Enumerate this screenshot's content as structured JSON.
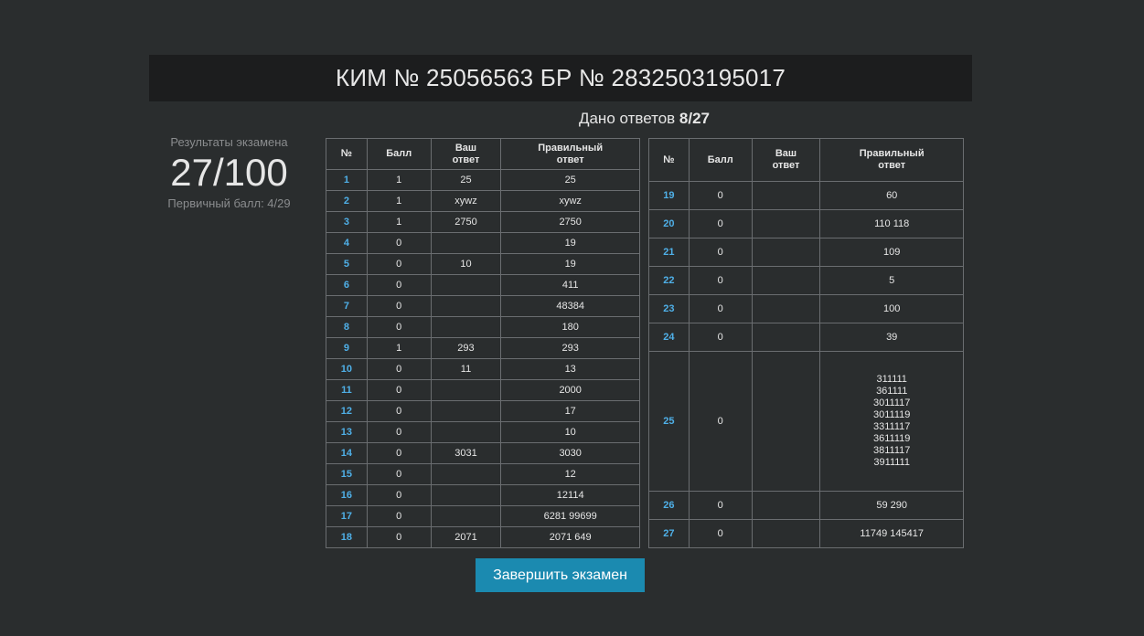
{
  "header": {
    "title": "КИМ № 25056563 БР № 2832503195017"
  },
  "answers_given": {
    "label": "Дано ответов",
    "value": "8/27"
  },
  "results": {
    "label": "Результаты экзамена",
    "score": "27/100",
    "primary": "Первичный балл: 4/29"
  },
  "columns": {
    "num": "№",
    "score": "Балл",
    "your_answer": "Ваш ответ",
    "correct_answer": "Правильный ответ"
  },
  "left_rows": [
    {
      "n": "1",
      "score": "1",
      "yours": "25",
      "correct": "25"
    },
    {
      "n": "2",
      "score": "1",
      "yours": "xywz",
      "correct": "xywz"
    },
    {
      "n": "3",
      "score": "1",
      "yours": "2750",
      "correct": "2750"
    },
    {
      "n": "4",
      "score": "0",
      "yours": "",
      "correct": "19"
    },
    {
      "n": "5",
      "score": "0",
      "yours": "10",
      "correct": "19"
    },
    {
      "n": "6",
      "score": "0",
      "yours": "",
      "correct": "411"
    },
    {
      "n": "7",
      "score": "0",
      "yours": "",
      "correct": "48384"
    },
    {
      "n": "8",
      "score": "0",
      "yours": "",
      "correct": "180"
    },
    {
      "n": "9",
      "score": "1",
      "yours": "293",
      "correct": "293"
    },
    {
      "n": "10",
      "score": "0",
      "yours": "11",
      "correct": "13"
    },
    {
      "n": "11",
      "score": "0",
      "yours": "",
      "correct": "2000"
    },
    {
      "n": "12",
      "score": "0",
      "yours": "",
      "correct": "17"
    },
    {
      "n": "13",
      "score": "0",
      "yours": "",
      "correct": "10"
    },
    {
      "n": "14",
      "score": "0",
      "yours": "3031",
      "correct": "3030"
    },
    {
      "n": "15",
      "score": "0",
      "yours": "",
      "correct": "12"
    },
    {
      "n": "16",
      "score": "0",
      "yours": "",
      "correct": "12114"
    },
    {
      "n": "17",
      "score": "0",
      "yours": "",
      "correct": "6281 99699"
    },
    {
      "n": "18",
      "score": "0",
      "yours": "2071",
      "correct": "2071 649"
    }
  ],
  "right_rows": [
    {
      "n": "19",
      "score": "0",
      "yours": "",
      "correct": [
        "60"
      ]
    },
    {
      "n": "20",
      "score": "0",
      "yours": "",
      "correct": [
        "110 118"
      ]
    },
    {
      "n": "21",
      "score": "0",
      "yours": "",
      "correct": [
        "109"
      ]
    },
    {
      "n": "22",
      "score": "0",
      "yours": "",
      "correct": [
        "5"
      ]
    },
    {
      "n": "23",
      "score": "0",
      "yours": "",
      "correct": [
        "100"
      ]
    },
    {
      "n": "24",
      "score": "0",
      "yours": "",
      "correct": [
        "39"
      ]
    },
    {
      "n": "25",
      "score": "0",
      "yours": "",
      "correct": [
        "311111",
        "361111",
        "3011117",
        "3011119",
        "3311117",
        "3611119",
        "3811117",
        "3911111"
      ]
    },
    {
      "n": "26",
      "score": "0",
      "yours": "",
      "correct": [
        "59 290"
      ]
    },
    {
      "n": "27",
      "score": "0",
      "yours": "",
      "correct": [
        "11749 145417"
      ]
    }
  ],
  "finish_button": {
    "label": "Завершить экзамен"
  },
  "colors": {
    "background": "#2a2d2e",
    "header": "#1c1d1e",
    "accent": "#1b8ab0",
    "link": "#4fb0e8"
  }
}
